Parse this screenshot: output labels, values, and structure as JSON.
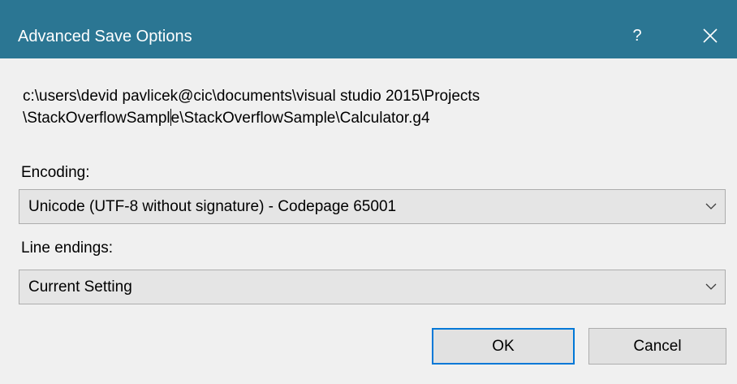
{
  "window": {
    "title": "Advanced Save Options",
    "help_label": "?"
  },
  "file_path": {
    "line1": "c:\\users\\devid pavlicek@cic\\documents\\visual studio 2015\\Projects",
    "line2_before_caret": "\\StackOverflowSampl",
    "line2_after_caret": "e\\StackOverflowSample\\Calculator.g4"
  },
  "encoding": {
    "label": "Encoding:",
    "selected": "Unicode (UTF-8 without signature) - Codepage 65001"
  },
  "line_endings": {
    "label": "Line endings:",
    "selected": "Current Setting"
  },
  "buttons": {
    "ok_label": "OK",
    "cancel_label": "Cancel"
  },
  "colors": {
    "titlebar": "#2b7693",
    "dialog_background": "#f0f0f0",
    "focus_border": "#0078d7"
  },
  "icons": {
    "close": "close-icon",
    "dropdown": "chevron-down-icon"
  }
}
